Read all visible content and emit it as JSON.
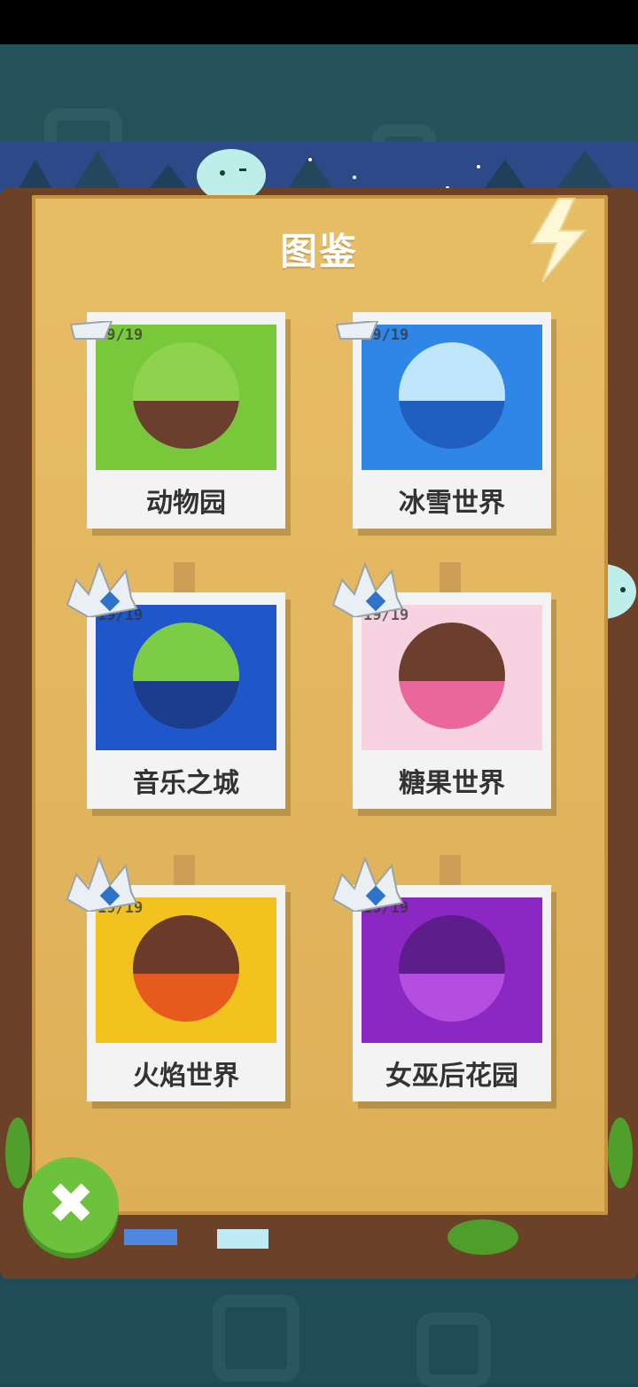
{
  "title": "图鉴",
  "colors": {
    "panel": "#e2b55d",
    "frame": "#6b4127",
    "close_button": "#6cc23a"
  },
  "worlds": [
    {
      "label": "动物园",
      "count": "19/19"
    },
    {
      "label": "冰雪世界",
      "count": "19/19"
    },
    {
      "label": "音乐之城",
      "count": "19/19"
    },
    {
      "label": "糖果世界",
      "count": "19/19"
    },
    {
      "label": "火焰世界",
      "count": "19/19"
    },
    {
      "label": "女巫后花园",
      "count": "19/19"
    }
  ],
  "icons": {
    "close": "close-icon",
    "crown": "crown-icon"
  }
}
